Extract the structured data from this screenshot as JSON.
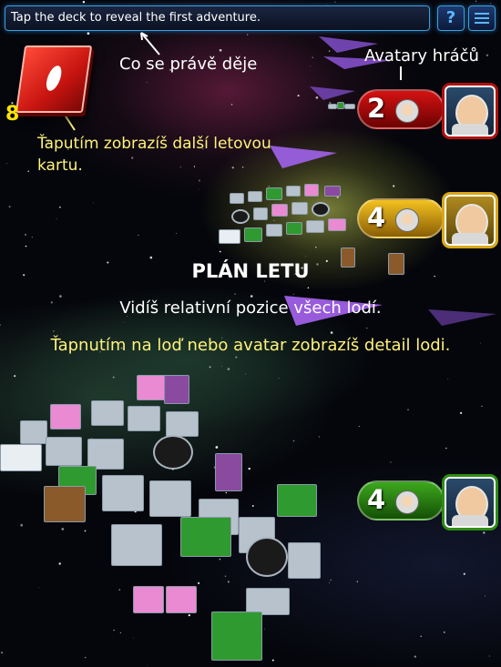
{
  "top_bar": {
    "status_text": "Tap the deck to reveal the first adventure.",
    "help_label": "?",
    "menu_icon": "hamburger-menu-icon"
  },
  "captions": {
    "what_now": "Co se právě děje",
    "avatars": "Avatary hráčů",
    "tap_deck": "Ťaputím zobrazíš další letovou kartu.",
    "flight_plan_title": "PLÁN LETU",
    "relative_positions": "Vidíš relativní pozice všech lodí.",
    "tap_ship": "Ťapnutím na loď nebo avatar zobrazíš detail lodi."
  },
  "deck": {
    "cards_remaining": "8",
    "icon": "adventure-card-deck-icon"
  },
  "players": [
    {
      "position": "2",
      "color": "red",
      "color_hex": "#c91414"
    },
    {
      "position": "4",
      "color": "yellow",
      "color_hex": "#e6b418"
    },
    {
      "position": "4",
      "color": "green",
      "color_hex": "#33a01c"
    }
  ],
  "colors": {
    "accent": "#3aa0e0",
    "caption_yellow": "#fff27a",
    "deck_count": "#ffe600"
  }
}
